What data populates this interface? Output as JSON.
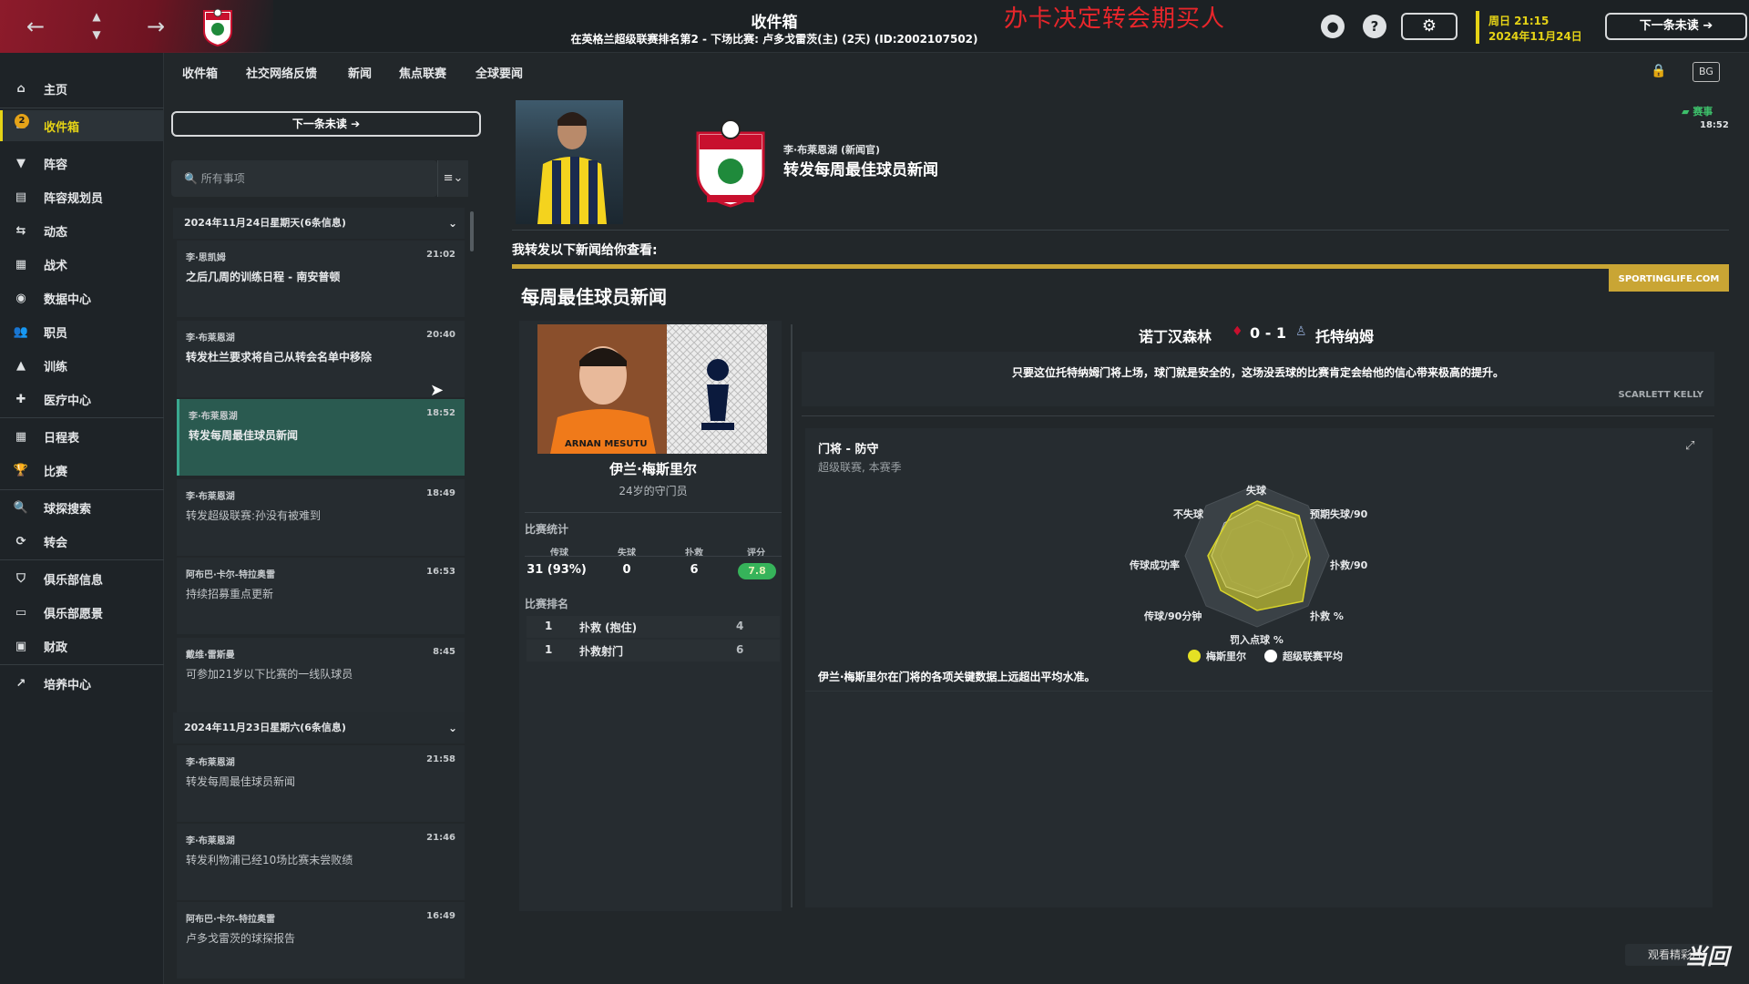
{
  "header": {
    "title": "收件箱",
    "subtitle": "在英格兰超级联赛排名第2 - 下场比赛: 卢多戈雷茨(主) (2天) (ID:2002107502)",
    "overlay_text": "办卡决定转会期买人",
    "date_line1": "周日 21:15",
    "date_line2": "2024年11月24日",
    "next_unread": "下一条未读"
  },
  "sidebar": {
    "badge": "2",
    "items": [
      {
        "label": "主页",
        "icon": "home-icon"
      },
      {
        "label": "收件箱",
        "icon": "inbox-icon"
      },
      {
        "label": "阵容",
        "icon": "shirt-icon"
      },
      {
        "label": "阵容规划员",
        "icon": "clipboard-icon"
      },
      {
        "label": "动态",
        "icon": "dynamics-icon"
      },
      {
        "label": "战术",
        "icon": "tactics-icon"
      },
      {
        "label": "数据中心",
        "icon": "data-icon"
      },
      {
        "label": "职员",
        "icon": "staff-icon"
      },
      {
        "label": "训练",
        "icon": "training-icon"
      },
      {
        "label": "医疗中心",
        "icon": "medical-icon"
      },
      {
        "label": "日程表",
        "icon": "calendar-icon"
      },
      {
        "label": "比赛",
        "icon": "trophy-icon"
      },
      {
        "label": "球探搜索",
        "icon": "search-icon"
      },
      {
        "label": "转会",
        "icon": "transfer-icon"
      },
      {
        "label": "俱乐部信息",
        "icon": "shield-icon"
      },
      {
        "label": "俱乐部愿景",
        "icon": "vision-icon"
      },
      {
        "label": "财政",
        "icon": "money-icon"
      },
      {
        "label": "培养中心",
        "icon": "development-icon"
      }
    ]
  },
  "tabs": [
    "收件箱",
    "社交网络反馈",
    "新闻",
    "焦点联赛",
    "全球要闻"
  ],
  "list": {
    "next_unread": "下一条未读",
    "search_placeholder": "所有事项",
    "groups": [
      {
        "title": "2024年11月24日星期天(6条信息)"
      },
      {
        "title": "2024年11月23日星期六(6条信息)"
      }
    ],
    "messages": [
      {
        "sender": "李·思凯姆",
        "time": "21:02",
        "subject": "之后几周的训练日程 - 南安普顿"
      },
      {
        "sender": "李·布莱恩湖",
        "time": "20:40",
        "subject": "转发杜兰要求将自己从转会名单中移除"
      },
      {
        "sender": "李·布莱恩湖",
        "time": "18:52",
        "subject": "转发每周最佳球员新闻"
      },
      {
        "sender": "李·布莱恩湖",
        "time": "18:49",
        "subject": "转发超级联赛:孙没有被难到"
      },
      {
        "sender": "阿布巴·卡尔-特拉奥雷",
        "time": "16:53",
        "subject": "持续招募重点更新"
      },
      {
        "sender": "戴维·雷斯曼",
        "time": "8:45",
        "subject": "可参加21岁以下比赛的一线队球员"
      },
      {
        "sender": "李·布莱恩湖",
        "time": "21:58",
        "subject": "转发每周最佳球员新闻"
      },
      {
        "sender": "李·布莱恩湖",
        "time": "21:46",
        "subject": "转发利物浦已经10场比赛未尝败绩"
      },
      {
        "sender": "阿布巴·卡尔-特拉奥雷",
        "time": "16:49",
        "subject": "卢多戈雷茨的球探报告"
      }
    ]
  },
  "message": {
    "sender": "李·布莱恩湖 (新闻官)",
    "title": "转发每周最佳球员新闻",
    "tag": "赛事",
    "time": "18:52",
    "forward_text": "我转发以下新闻给你查看:",
    "source": "SPORTINGLIFE.COM",
    "news_title": "每周最佳球员新闻",
    "img_caption": "ARNAN MESUTU"
  },
  "player": {
    "name": "伊兰·梅斯里尔",
    "desc": "24岁的守门员",
    "stats_label": "比赛统计",
    "stat_heads": [
      "传球",
      "失球",
      "扑救",
      "评分"
    ],
    "stat_values": [
      "31 (93%)",
      "0",
      "6",
      "7.8"
    ],
    "rank_label": "比赛排名",
    "ranks": [
      {
        "rank": "1",
        "name": "扑救 (抱住)",
        "value": "4"
      },
      {
        "rank": "1",
        "name": "扑救射门",
        "value": "6"
      }
    ]
  },
  "match": {
    "home": "诺丁汉森林",
    "score": "0 - 1",
    "away": "托特纳姆",
    "quote": "只要这位托特纳姆门将上场，球门就是安全的，这场没丢球的比赛肯定会给他的信心带来极高的提升。",
    "author": "SCARLETT KELLY"
  },
  "radar": {
    "title": "门将 - 防守",
    "subtitle": "超级联赛, 本赛季",
    "axes": [
      "失球",
      "预期失球/90",
      "扑救/90",
      "扑救 %",
      "罚入点球 %",
      "传球/90分钟",
      "传球成功率",
      "不失球"
    ],
    "legend_player": "梅斯里尔",
    "legend_avg": "超级联赛平均",
    "note": "伊兰·梅斯里尔在门将的各项关键数据上远超出平均水准。",
    "colors": {
      "player": "#e5e024",
      "avg": "#ffffff"
    }
  },
  "footer": {
    "watch_label": "观看精彩片",
    "watermark": "当回"
  }
}
